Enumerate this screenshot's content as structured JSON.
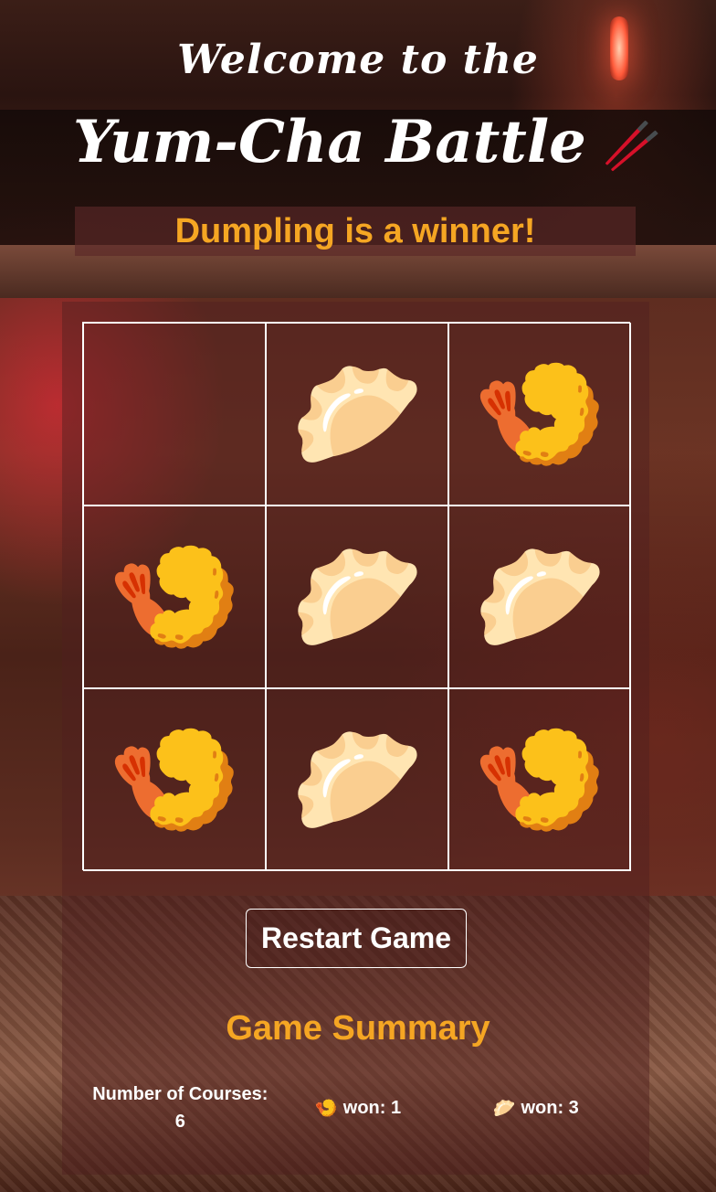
{
  "header": {
    "welcome": "Welcome to the",
    "title": "Yum-Cha Battle",
    "title_icon": "🥢"
  },
  "status": {
    "message": "Dumpling is a winner!"
  },
  "board": {
    "cells": [
      {
        "piece": "",
        "name": "empty"
      },
      {
        "piece": "🥟",
        "name": "dumpling"
      },
      {
        "piece": "🍤",
        "name": "shrimp"
      },
      {
        "piece": "🍤",
        "name": "shrimp"
      },
      {
        "piece": "🥟",
        "name": "dumpling"
      },
      {
        "piece": "🥟",
        "name": "dumpling"
      },
      {
        "piece": "🍤",
        "name": "shrimp"
      },
      {
        "piece": "🥟",
        "name": "dumpling"
      },
      {
        "piece": "🍤",
        "name": "shrimp"
      }
    ]
  },
  "controls": {
    "restart_label": "Restart Game"
  },
  "summary": {
    "title": "Game Summary",
    "courses_label": "Number of Courses: 6",
    "shrimp_icon": "🍤",
    "shrimp_won": "won: 1",
    "dumpling_icon": "🥟",
    "dumpling_won": "won: 3"
  },
  "colors": {
    "accent": "#f5a623",
    "text": "#ffffff"
  }
}
